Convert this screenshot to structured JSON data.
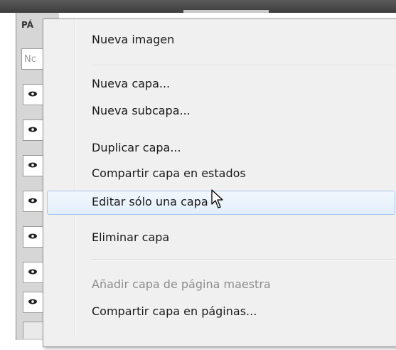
{
  "background_panel": {
    "title": "PÁ",
    "search_placeholder": "Nc"
  },
  "menu": {
    "items": [
      {
        "label": "Nueva imagen",
        "state": "enabled"
      },
      {
        "label": "Nueva capa...",
        "state": "enabled"
      },
      {
        "label": "Nueva subcapa...",
        "state": "enabled"
      },
      {
        "label": "Duplicar capa...",
        "state": "enabled"
      },
      {
        "label": "Compartir capa en estados",
        "state": "enabled"
      },
      {
        "label": "Editar sólo una capa",
        "state": "hover"
      },
      {
        "label": "Eliminar capa",
        "state": "enabled"
      },
      {
        "label": "Añadir capa de página maestra",
        "state": "disabled"
      },
      {
        "label": "Compartir capa en páginas...",
        "state": "enabled"
      },
      {
        "label": "",
        "state": "cut-off"
      }
    ]
  },
  "colors": {
    "menu_bg": "#f0f0f0",
    "hover_border": "#a8c8ec",
    "disabled_text": "#8c8c8c"
  }
}
